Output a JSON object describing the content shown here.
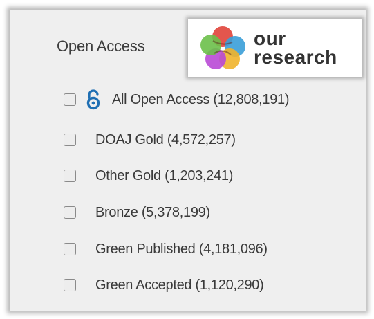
{
  "filter": {
    "title": "Open Access",
    "items": [
      {
        "label": "All Open Access (12,808,191)",
        "checked": false,
        "icon": "open-access-lock-icon"
      },
      {
        "label": "DOAJ Gold (4,572,257)",
        "checked": false
      },
      {
        "label": "Other Gold (1,203,241)",
        "checked": false
      },
      {
        "label": "Bronze (5,378,199)",
        "checked": false
      },
      {
        "label": "Green Published (4,181,096)",
        "checked": false
      },
      {
        "label": "Green Accepted (1,120,290)",
        "checked": false
      }
    ]
  },
  "logo": {
    "line1": "our",
    "line2": "research",
    "colors": [
      "#e0443a",
      "#3a9ed8",
      "#f0b42c",
      "#b94ad6",
      "#6cc04a"
    ]
  },
  "colors": {
    "panel_bg": "#efefef",
    "oa_icon": "#1f6fb3",
    "text": "#3a3a3a"
  }
}
